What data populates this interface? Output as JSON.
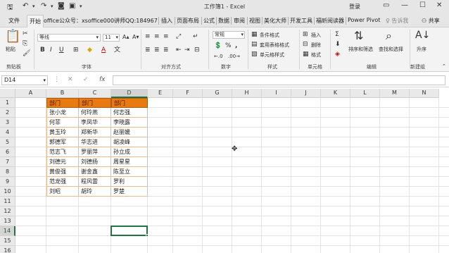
{
  "titlebar": {
    "title": "工作簿1 - Excel",
    "login": "登录",
    "save_icon": "save-icon",
    "undo_icon": "undo-icon",
    "redo_icon": "redo-icon",
    "camera_icon": "camera-icon",
    "screenshot_icon": "screenshot-icon",
    "customize_icon": "customize-quick-access-icon"
  },
  "tabs": [
    "文件",
    "开始",
    "office公众号：xsoffice000",
    "讲师QQ:184967",
    "插入",
    "页面布局",
    "公式",
    "数据",
    "审阅",
    "视图",
    "美化大师",
    "开发工具",
    "福昕阅读器",
    "Power Pivot",
    "告诉我",
    "共享"
  ],
  "ribbon": {
    "paste": "粘贴",
    "clipboard": "剪贴板",
    "font_name": "等线",
    "font_size": "11",
    "font_group": "字体",
    "alignment_group": "对齐方式",
    "number_format": "常规",
    "number_group": "数字",
    "conditional_format": "条件格式",
    "format_as_table": "套用表格格式",
    "cell_styles": "单元格样式",
    "styles_group": "样式",
    "insert": "插入",
    "delete": "删除",
    "format": "格式",
    "cells_group": "单元格",
    "sort_filter": "排序和筛选",
    "find_select": "查找和选择",
    "editing_group": "编辑",
    "upgrade": "升序",
    "new_group": "新建组",
    "bold": "B",
    "italic": "I",
    "underline": "U",
    "font_color_letter": "A",
    "percent": "%",
    "comma": ","
  },
  "formula_bar": {
    "name_box": "D14",
    "cancel": "✕",
    "enter": "✓",
    "fx": "fx",
    "formula": ""
  },
  "grid": {
    "columns": [
      "A",
      "B",
      "C",
      "D",
      "E",
      "F",
      "G",
      "H",
      "I",
      "J",
      "K",
      "L",
      "M",
      "N"
    ],
    "rows": [
      "1",
      "2",
      "3",
      "4",
      "5",
      "6",
      "7",
      "8",
      "9",
      "10",
      "11",
      "12",
      "13",
      "14",
      "15",
      "16"
    ],
    "selected_column": "D",
    "selected_row": "14",
    "header_row": [
      "部门",
      "部门",
      "部门"
    ],
    "data_rows": [
      [
        "张小龙",
        "何玲燕",
        "何志强"
      ],
      [
        "何菲",
        "李凤华",
        "李晓露"
      ],
      [
        "黄玉玲",
        "郑新华",
        "赵丽媛"
      ],
      [
        "郭德军",
        "华志进",
        "胡凌峰"
      ],
      [
        "范志飞",
        "罗丽萍",
        "孙立成"
      ],
      [
        "刘德元",
        "刘德扬",
        "周星星"
      ],
      [
        "黄俊强",
        "谢金鑫",
        "陈至立"
      ],
      [
        "范龙强",
        "程风雷",
        "罗利"
      ],
      [
        "刘昭",
        "胡玲",
        "罗楚"
      ]
    ]
  },
  "colors": {
    "header_fill": "#e97a0f",
    "selection_accent": "#217346"
  }
}
